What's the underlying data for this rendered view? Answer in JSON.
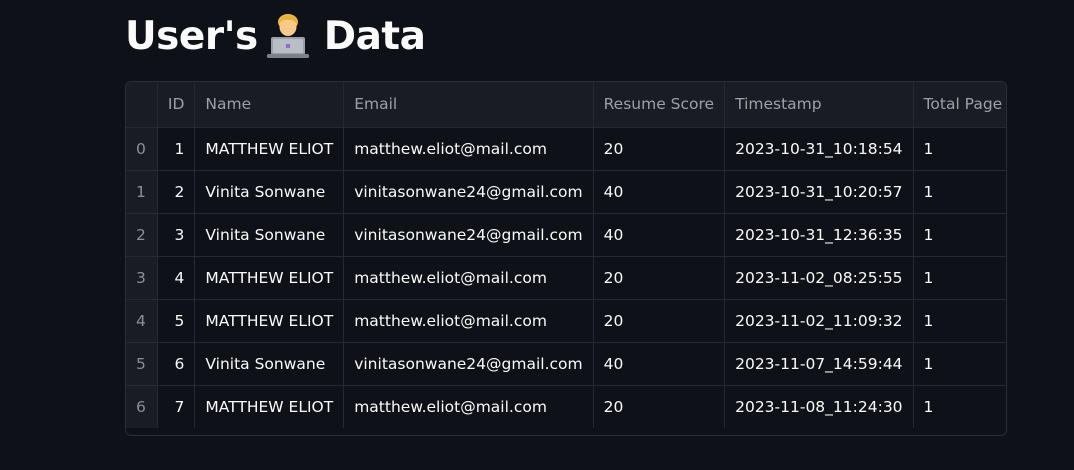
{
  "page": {
    "title_before": "User's",
    "title_after": "Data",
    "title_emoji": "technologist-emoji"
  },
  "table": {
    "columns": [
      "",
      "ID",
      "Name",
      "Email",
      "Resume Score",
      "Timestamp",
      "Total Page"
    ],
    "rows": [
      {
        "index": "0",
        "id": "1",
        "name": "MATTHEW ELIOT",
        "email": "matthew.eliot@mail.com",
        "score": "20",
        "timestamp": "2023-10-31_10:18:54",
        "pages": "1"
      },
      {
        "index": "1",
        "id": "2",
        "name": "Vinita Sonwane",
        "email": "vinitasonwane24@gmail.com",
        "score": "40",
        "timestamp": "2023-10-31_10:20:57",
        "pages": "1"
      },
      {
        "index": "2",
        "id": "3",
        "name": "Vinita Sonwane",
        "email": "vinitasonwane24@gmail.com",
        "score": "40",
        "timestamp": "2023-10-31_12:36:35",
        "pages": "1"
      },
      {
        "index": "3",
        "id": "4",
        "name": "MATTHEW ELIOT",
        "email": "matthew.eliot@mail.com",
        "score": "20",
        "timestamp": "2023-11-02_08:25:55",
        "pages": "1"
      },
      {
        "index": "4",
        "id": "5",
        "name": "MATTHEW ELIOT",
        "email": "matthew.eliot@mail.com",
        "score": "20",
        "timestamp": "2023-11-02_11:09:32",
        "pages": "1"
      },
      {
        "index": "5",
        "id": "6",
        "name": "Vinita Sonwane",
        "email": "vinitasonwane24@gmail.com",
        "score": "40",
        "timestamp": "2023-11-07_14:59:44",
        "pages": "1"
      },
      {
        "index": "6",
        "id": "7",
        "name": "MATTHEW ELIOT",
        "email": "matthew.eliot@mail.com",
        "score": "20",
        "timestamp": "2023-11-08_11:24:30",
        "pages": "1"
      }
    ]
  },
  "colors": {
    "background": "#0e1117",
    "header_background": "#1a1c24",
    "border": "#262930",
    "text": "#fafafa",
    "muted_text": "#9da0a6"
  }
}
